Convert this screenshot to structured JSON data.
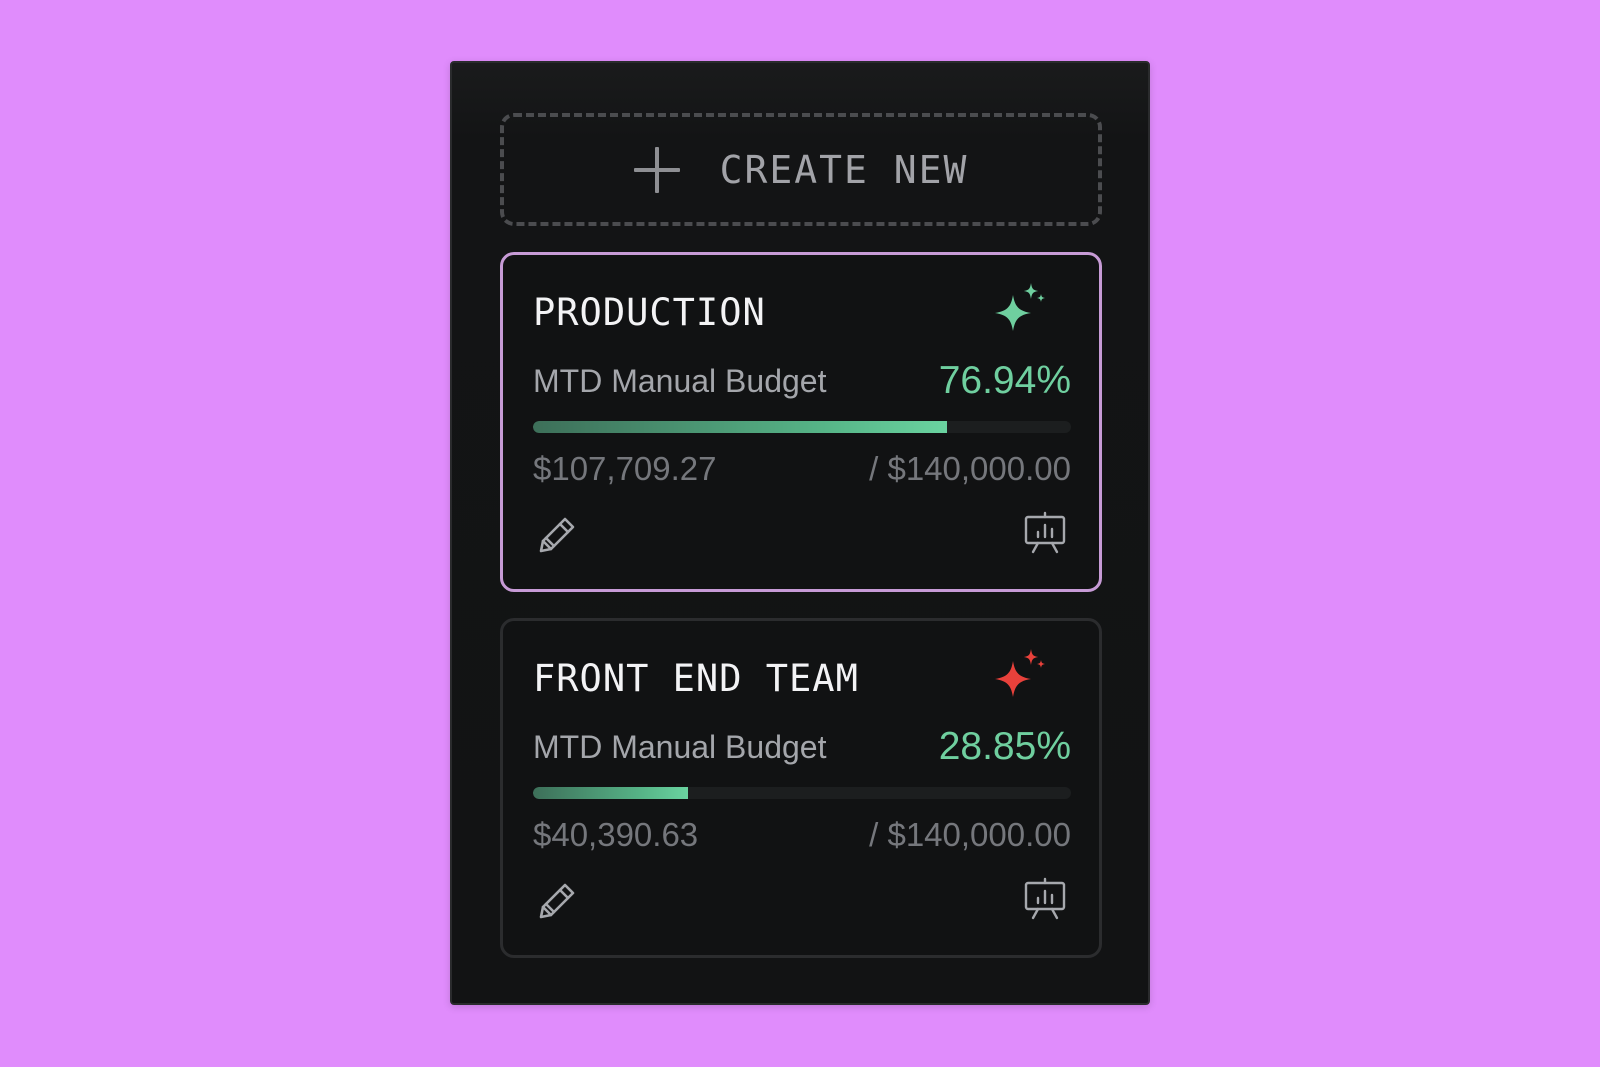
{
  "create_new": {
    "label": "CREATE NEW",
    "icon": "plus-icon"
  },
  "cards": [
    {
      "title": "PRODUCTION",
      "sparkle_color": "#6fcf9f",
      "budget_label": "MTD Manual Budget",
      "percent_text": "76.94%",
      "percent_value": 76.94,
      "spent": "$107,709.27",
      "total": "/ $140,000.00",
      "selected": true,
      "icons": [
        "pencil-icon",
        "presentation-chart-icon"
      ]
    },
    {
      "title": "FRONT END TEAM",
      "sparkle_color": "#e8413b",
      "budget_label": "MTD Manual Budget",
      "percent_text": "28.85%",
      "percent_value": 28.85,
      "spent": "$40,390.63",
      "total": "/ $140,000.00",
      "selected": false,
      "icons": [
        "pencil-icon",
        "presentation-chart-icon"
      ]
    }
  ],
  "colors": {
    "background": "#e08cfc",
    "panel": "#121314",
    "accent_green": "#6fcf9f",
    "selected_border": "#c79bd6"
  }
}
